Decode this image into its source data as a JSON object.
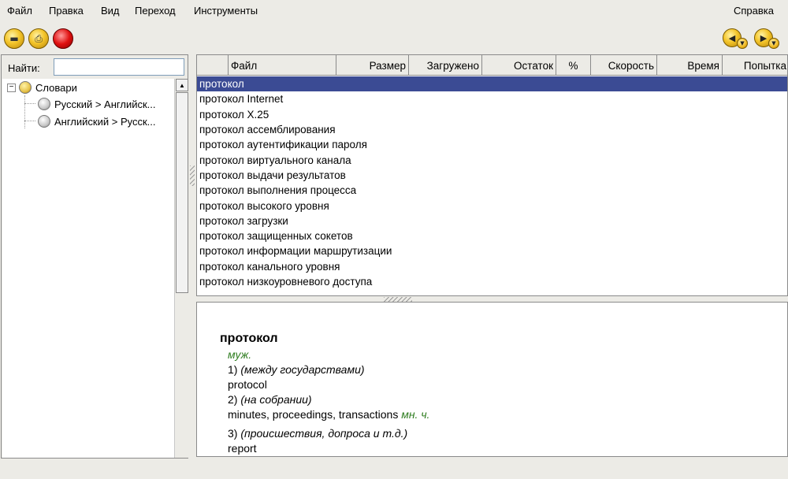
{
  "menu": {
    "file": "Файл",
    "edit": "Правка",
    "view": "Вид",
    "go": "Переход",
    "tools": "Инструменты",
    "help": "Справка"
  },
  "toolbar": {
    "icons": [
      "scanner-icon",
      "print-icon",
      "stop-icon",
      "back-icon",
      "forward-icon"
    ]
  },
  "search": {
    "label": "Найти:",
    "value": ""
  },
  "tree": {
    "root": "Словари",
    "items": [
      "Русский > Английск...",
      "Английский > Русск..."
    ]
  },
  "list": {
    "columns": [
      "Файл",
      "Размер",
      "Загружено",
      "Остаток",
      "%",
      "Скорость",
      "Время",
      "Попытка"
    ],
    "rows": [
      "протокол",
      "протокол Internet",
      "протокол X.25",
      "протокол ассемблирования",
      "протокол аутентификации пароля",
      "протокол виртуального канала",
      "протокол выдачи результатов",
      "протокол выполнения процесса",
      "протокол высокого уровня",
      "протокол загрузки",
      "протокол защищенных сокетов",
      "протокол информации маршрутизации",
      "протокол канального уровня",
      "протокол низкоуровневого доступа"
    ],
    "selected_index": 0
  },
  "article": {
    "headword": "протокол",
    "gender": "муж.",
    "sense1_num": "1)",
    "sense1_note": "(между государствами)",
    "sense1_trans": "protocol",
    "sense2_num": "2)",
    "sense2_note": "(на собрании)",
    "sense2_trans": "minutes, proceedings, transactions",
    "sense2_mark": "мн. ч.",
    "sense3_num": "3)",
    "sense3_note": "(происшествия, допроса и т.д.)",
    "sense3_trans": "report"
  },
  "colors": {
    "selection": "#3b4b94",
    "label_green": "#2e7d1f",
    "background": "#ecebe6"
  }
}
